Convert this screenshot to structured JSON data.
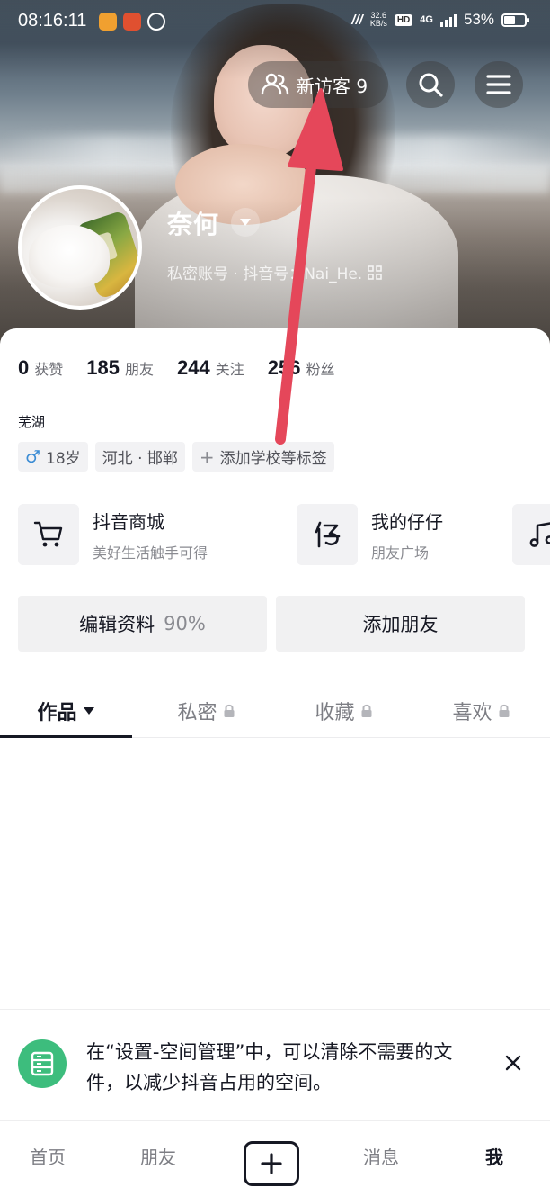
{
  "status_bar": {
    "time": "08:16:11",
    "speed_top": "32.6",
    "speed_bottom": "KB/s",
    "hd_label": "HD",
    "network": "4G",
    "battery": "53%",
    "battery_level": 0.53
  },
  "header": {
    "visitor_label": "新访客 9",
    "search_icon": "search-icon",
    "menu_icon": "menu-icon"
  },
  "profile": {
    "name": "奈何",
    "subline": "私密账号 · 抖音号：Nai_He.",
    "stats": [
      {
        "num": "0",
        "label": "获赞"
      },
      {
        "num": "185",
        "label": "朋友"
      },
      {
        "num": "244",
        "label": "关注"
      },
      {
        "num": "256",
        "label": "粉丝"
      }
    ],
    "location": "芜湖",
    "tags": {
      "age": "18岁",
      "region": "河北 · 邯郸",
      "add": "添加学校等标签"
    }
  },
  "shortcuts": [
    {
      "title": "抖音商城",
      "sub": "美好生活触手可得",
      "icon": "cart-icon"
    },
    {
      "title": "我的仔仔",
      "sub": "朋友广场",
      "icon": "zaizai-icon"
    },
    {
      "title": "",
      "sub": "",
      "icon": "music-icon"
    }
  ],
  "actions": {
    "edit_label": "编辑资料",
    "edit_pct": "90%",
    "add_friend_label": "添加朋友"
  },
  "tabs": [
    {
      "label": "作品"
    },
    {
      "label": "私密"
    },
    {
      "label": "收藏"
    },
    {
      "label": "喜欢"
    }
  ],
  "tip": {
    "text": "在“设置-空间管理”中，可以清除不需要的文件，以减少抖音占用的空间。"
  },
  "bottom_nav": {
    "home": "首页",
    "friends": "朋友",
    "messages": "消息",
    "me": "我"
  },
  "colors": {
    "arrow": "#e5475a",
    "tip_icon": "#3dbd7d",
    "male": "#3b8cd4"
  }
}
